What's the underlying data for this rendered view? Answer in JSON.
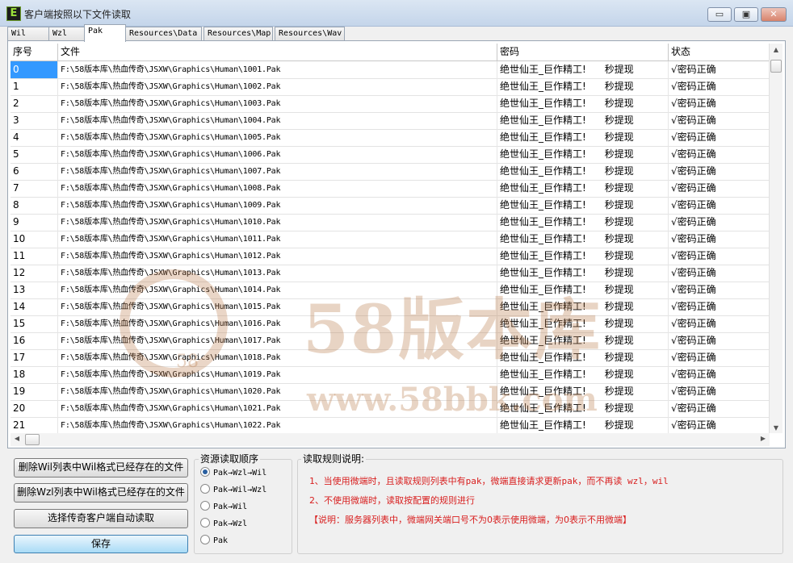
{
  "window": {
    "title": "客户端按照以下文件读取",
    "icon_letter": "E",
    "minimize": "▭",
    "maximize": "▣",
    "close": "✕"
  },
  "tabs": [
    "Wil",
    "Wzl",
    "Pak",
    "Resources\\Data",
    "Resources\\Map",
    "Resources\\Wav"
  ],
  "active_tab": "Pak",
  "table": {
    "headers": [
      "序号",
      "文件",
      "密码",
      "状态"
    ],
    "rows": [
      {
        "index": "0",
        "file": "F:\\58版本库\\热血传奇\\JSXW\\Graphics\\Human\\1001.Pak",
        "password": "绝世仙王_巨作精工!      秒提现",
        "status": "√密码正确"
      },
      {
        "index": "1",
        "file": "F:\\58版本库\\热血传奇\\JSXW\\Graphics\\Human\\1002.Pak",
        "password": "绝世仙王_巨作精工!      秒提现",
        "status": "√密码正确"
      },
      {
        "index": "2",
        "file": "F:\\58版本库\\热血传奇\\JSXW\\Graphics\\Human\\1003.Pak",
        "password": "绝世仙王_巨作精工!      秒提现",
        "status": "√密码正确"
      },
      {
        "index": "3",
        "file": "F:\\58版本库\\热血传奇\\JSXW\\Graphics\\Human\\1004.Pak",
        "password": "绝世仙王_巨作精工!      秒提现",
        "status": "√密码正确"
      },
      {
        "index": "4",
        "file": "F:\\58版本库\\热血传奇\\JSXW\\Graphics\\Human\\1005.Pak",
        "password": "绝世仙王_巨作精工!      秒提现",
        "status": "√密码正确"
      },
      {
        "index": "5",
        "file": "F:\\58版本库\\热血传奇\\JSXW\\Graphics\\Human\\1006.Pak",
        "password": "绝世仙王_巨作精工!      秒提现",
        "status": "√密码正确"
      },
      {
        "index": "6",
        "file": "F:\\58版本库\\热血传奇\\JSXW\\Graphics\\Human\\1007.Pak",
        "password": "绝世仙王_巨作精工!      秒提现",
        "status": "√密码正确"
      },
      {
        "index": "7",
        "file": "F:\\58版本库\\热血传奇\\JSXW\\Graphics\\Human\\1008.Pak",
        "password": "绝世仙王_巨作精工!      秒提现",
        "status": "√密码正确"
      },
      {
        "index": "8",
        "file": "F:\\58版本库\\热血传奇\\JSXW\\Graphics\\Human\\1009.Pak",
        "password": "绝世仙王_巨作精工!      秒提现",
        "status": "√密码正确"
      },
      {
        "index": "9",
        "file": "F:\\58版本库\\热血传奇\\JSXW\\Graphics\\Human\\1010.Pak",
        "password": "绝世仙王_巨作精工!      秒提现",
        "status": "√密码正确"
      },
      {
        "index": "10",
        "file": "F:\\58版本库\\热血传奇\\JSXW\\Graphics\\Human\\1011.Pak",
        "password": "绝世仙王_巨作精工!      秒提现",
        "status": "√密码正确"
      },
      {
        "index": "11",
        "file": "F:\\58版本库\\热血传奇\\JSXW\\Graphics\\Human\\1012.Pak",
        "password": "绝世仙王_巨作精工!      秒提现",
        "status": "√密码正确"
      },
      {
        "index": "12",
        "file": "F:\\58版本库\\热血传奇\\JSXW\\Graphics\\Human\\1013.Pak",
        "password": "绝世仙王_巨作精工!      秒提现",
        "status": "√密码正确"
      },
      {
        "index": "13",
        "file": "F:\\58版本库\\热血传奇\\JSXW\\Graphics\\Human\\1014.Pak",
        "password": "绝世仙王_巨作精工!      秒提现",
        "status": "√密码正确"
      },
      {
        "index": "14",
        "file": "F:\\58版本库\\热血传奇\\JSXW\\Graphics\\Human\\1015.Pak",
        "password": "绝世仙王_巨作精工!      秒提现",
        "status": "√密码正确"
      },
      {
        "index": "15",
        "file": "F:\\58版本库\\热血传奇\\JSXW\\Graphics\\Human\\1016.Pak",
        "password": "绝世仙王_巨作精工!      秒提现",
        "status": "√密码正确"
      },
      {
        "index": "16",
        "file": "F:\\58版本库\\热血传奇\\JSXW\\Graphics\\Human\\1017.Pak",
        "password": "绝世仙王_巨作精工!      秒提现",
        "status": "√密码正确"
      },
      {
        "index": "17",
        "file": "F:\\58版本库\\热血传奇\\JSXW\\Graphics\\Human\\1018.Pak",
        "password": "绝世仙王_巨作精工!      秒提现",
        "status": "√密码正确"
      },
      {
        "index": "18",
        "file": "F:\\58版本库\\热血传奇\\JSXW\\Graphics\\Human\\1019.Pak",
        "password": "绝世仙王_巨作精工!      秒提现",
        "status": "√密码正确"
      },
      {
        "index": "19",
        "file": "F:\\58版本库\\热血传奇\\JSXW\\Graphics\\Human\\1020.Pak",
        "password": "绝世仙王_巨作精工!      秒提现",
        "status": "√密码正确"
      },
      {
        "index": "20",
        "file": "F:\\58版本库\\热血传奇\\JSXW\\Graphics\\Human\\1021.Pak",
        "password": "绝世仙王_巨作精工!      秒提现",
        "status": "√密码正确"
      },
      {
        "index": "21",
        "file": "F:\\58版本库\\热血传奇\\JSXW\\Graphics\\Human\\1022.Pak",
        "password": "绝世仙王_巨作精工!      秒提现",
        "status": "√密码正确"
      }
    ]
  },
  "buttons": {
    "delete_wil": "删除Wil列表中Wil格式已经存在的文件",
    "delete_wzl": "删除Wzl列表中Wil格式已经存在的文件",
    "auto_read": "选择传奇客户端自动读取",
    "save": "保存"
  },
  "order_group": {
    "title": "资源读取顺序",
    "options": [
      "Pak→Wzl→Wil",
      "Pak→Wil→Wzl",
      "Pak→Wil",
      "Pak→Wzl",
      "Pak"
    ],
    "selected": 0
  },
  "rules": {
    "title": "读取规则说明:",
    "line1": "1、当使用微端时，且读取规则列表中有pak，微端直接请求更新pak，而不再读 wzl，wil",
    "line2": "2、不使用微端时，读取按配置的规则进行",
    "line3": "【说明：服务器列表中，微端网关端口号不为0表示使用微端，为0表示不用微端】"
  },
  "watermark": {
    "big": "58版本库",
    "url": "www.58bbk.com",
    "badge": "58"
  },
  "scrollbar_arrows": {
    "up": "▲",
    "down": "▼",
    "left": "◀",
    "right": "▶"
  },
  "colors": {
    "selection": "#3399ff",
    "rule_text": "#d81e1e",
    "watermark": "#b97846"
  }
}
